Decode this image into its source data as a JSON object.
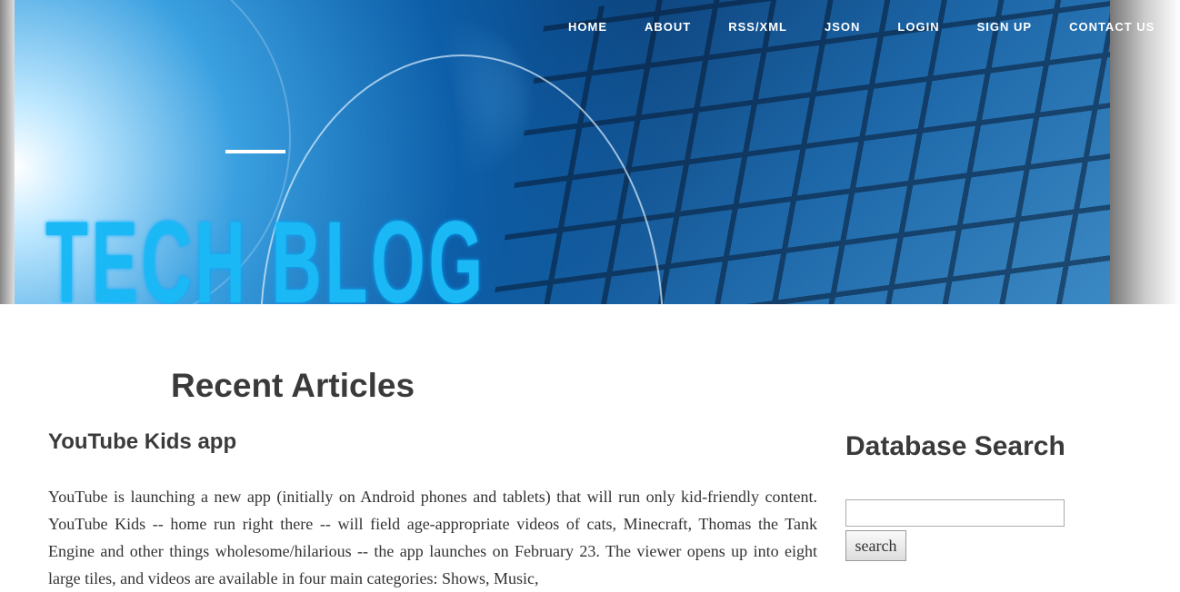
{
  "header": {
    "logo_text": "TECH BLOG",
    "nav": [
      "HOME",
      "ABOUT",
      "RSS/XML",
      "JSON",
      "LOGIN",
      "SIGN UP",
      "CONTACT US"
    ]
  },
  "main": {
    "heading": "Recent Articles",
    "article": {
      "title": "YouTube Kids app",
      "body": "YouTube is launching a new app (initially on Android phones and tablets) that will run only kid-friendly content. YouTube Kids -- home run right there -- will field age-appropriate videos of cats, Minecraft, Thomas the Tank Engine and other things wholesome/hilarious -- the app launches on February 23. The viewer opens up into eight large tiles, and videos are available in four main categories: Shows, Music,"
    }
  },
  "sidebar": {
    "title": "Database Search",
    "search_value": "",
    "button": "search"
  }
}
